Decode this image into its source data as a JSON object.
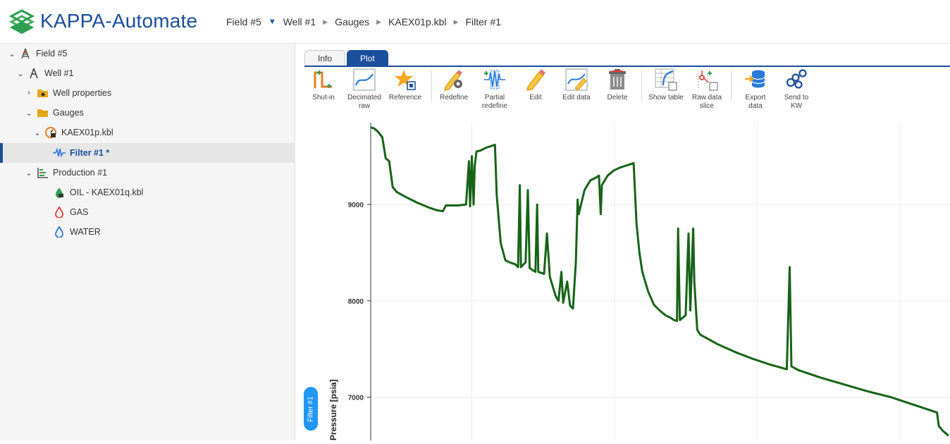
{
  "app": {
    "title": "KAPPA-Automate"
  },
  "breadcrumb": [
    "Field #5",
    "Well #1",
    "Gauges",
    "KAEX01p.kbl",
    "Filter #1"
  ],
  "tree": [
    {
      "label": "Field #5",
      "icon": "derrick-icon"
    },
    {
      "label": "Well #1",
      "icon": "well-icon"
    },
    {
      "label": "Well properties",
      "icon": "folder-props-icon"
    },
    {
      "label": "Gauges",
      "icon": "folder-icon"
    },
    {
      "label": "KAEX01p.kbl",
      "icon": "gauge-file-icon"
    },
    {
      "label": "Filter #1 *",
      "icon": "filter-signal-icon"
    },
    {
      "label": "Production #1",
      "icon": "production-icon"
    },
    {
      "label": "OIL - KAEX01q.kbl",
      "icon": "oil-drop-icon"
    },
    {
      "label": "GAS",
      "icon": "gas-drop-icon"
    },
    {
      "label": "WATER",
      "icon": "water-drop-icon"
    }
  ],
  "tabs": {
    "info": "Info",
    "plot": "Plot"
  },
  "toolbar": {
    "shut_in": "Shut-in",
    "decimated_raw": [
      "Decimated",
      "raw"
    ],
    "reference": "Reference",
    "redefine": "Redefine",
    "partial_redefine": [
      "Partial",
      "redefine"
    ],
    "edit": "Edit",
    "edit_data": "Edit data",
    "delete": "Delete",
    "show_table": "Show table",
    "raw_data_slice": [
      "Raw data",
      "slice"
    ],
    "export_data": [
      "Export",
      "data"
    ],
    "send_to_kw": [
      "Send to",
      "KW"
    ]
  },
  "side_tab": "Filter #1",
  "colors": {
    "brand": "#1b4e9b",
    "series": "#176317",
    "pill": "#2196f3"
  },
  "chart_data": {
    "type": "line",
    "ylabel": "Pressure [psia]",
    "yticks": [
      9000,
      8000,
      7000
    ],
    "ylim": [
      6550,
      9850
    ],
    "xlim": [
      0,
      100
    ],
    "grid": true,
    "series": [
      {
        "points": [
          [
            0.0,
            9800
          ],
          [
            0.6,
            9790
          ],
          [
            1.2,
            9760
          ],
          [
            2.0,
            9700
          ],
          [
            2.6,
            9480
          ],
          [
            3.2,
            9450
          ],
          [
            3.8,
            9180
          ],
          [
            4.5,
            9130
          ],
          [
            6.0,
            9080
          ],
          [
            8.0,
            9020
          ],
          [
            10.0,
            8970
          ],
          [
            11.5,
            8940
          ],
          [
            12.5,
            8930
          ],
          [
            13.0,
            8990
          ],
          [
            15.0,
            8990
          ],
          [
            16.5,
            9000
          ],
          [
            17.0,
            9450
          ],
          [
            17.2,
            8980
          ],
          [
            17.5,
            9500
          ],
          [
            17.8,
            9000
          ],
          [
            18.0,
            9400
          ],
          [
            18.3,
            9550
          ],
          [
            19.0,
            9560
          ],
          [
            20.0,
            9590
          ],
          [
            21.0,
            9610
          ],
          [
            21.5,
            9620
          ],
          [
            21.8,
            9100
          ],
          [
            22.5,
            8600
          ],
          [
            23.3,
            8420
          ],
          [
            24.0,
            8400
          ],
          [
            25.0,
            8380
          ],
          [
            25.5,
            8350
          ],
          [
            25.8,
            9200
          ],
          [
            26.0,
            8350
          ],
          [
            26.8,
            8400
          ],
          [
            27.2,
            9150
          ],
          [
            27.5,
            8340
          ],
          [
            28.5,
            8300
          ],
          [
            28.8,
            9000
          ],
          [
            29.0,
            8300
          ],
          [
            30.0,
            8280
          ],
          [
            30.5,
            8700
          ],
          [
            31.0,
            8250
          ],
          [
            31.5,
            8150
          ],
          [
            32.0,
            8050
          ],
          [
            32.5,
            8000
          ],
          [
            33.0,
            8300
          ],
          [
            33.3,
            7980
          ],
          [
            34.0,
            8200
          ],
          [
            34.5,
            7950
          ],
          [
            35.0,
            7920
          ],
          [
            35.5,
            8400
          ],
          [
            35.8,
            9050
          ],
          [
            36.0,
            8900
          ],
          [
            37.0,
            9150
          ],
          [
            38.0,
            9250
          ],
          [
            39.0,
            9280
          ],
          [
            39.5,
            9300
          ],
          [
            39.8,
            8900
          ],
          [
            40.0,
            9200
          ],
          [
            41.0,
            9300
          ],
          [
            42.0,
            9350
          ],
          [
            43.0,
            9380
          ],
          [
            44.0,
            9400
          ],
          [
            45.0,
            9420
          ],
          [
            45.5,
            9430
          ],
          [
            46.0,
            8800
          ],
          [
            46.5,
            8500
          ],
          [
            47.0,
            8300
          ],
          [
            48.0,
            8100
          ],
          [
            49.0,
            7960
          ],
          [
            50.0,
            7900
          ],
          [
            51.0,
            7850
          ],
          [
            52.0,
            7820
          ],
          [
            52.5,
            7800
          ],
          [
            53.0,
            7790
          ],
          [
            53.2,
            8750
          ],
          [
            53.5,
            7800
          ],
          [
            54.5,
            7850
          ],
          [
            55.0,
            8700
          ],
          [
            55.3,
            7900
          ],
          [
            55.8,
            8750
          ],
          [
            56.0,
            8200
          ],
          [
            56.5,
            7700
          ],
          [
            57.0,
            7650
          ],
          [
            60.0,
            7550
          ],
          [
            63.0,
            7470
          ],
          [
            66.0,
            7400
          ],
          [
            69.0,
            7340
          ],
          [
            72.0,
            7290
          ],
          [
            72.5,
            8350
          ],
          [
            72.8,
            7320
          ],
          [
            74.0,
            7280
          ],
          [
            78.0,
            7200
          ],
          [
            82.0,
            7130
          ],
          [
            86.0,
            7060
          ],
          [
            90.0,
            7000
          ],
          [
            94.0,
            6920
          ],
          [
            97.0,
            6860
          ],
          [
            98.0,
            6840
          ],
          [
            98.3,
            6700
          ],
          [
            99.0,
            6650
          ],
          [
            100.0,
            6600
          ]
        ]
      }
    ]
  }
}
